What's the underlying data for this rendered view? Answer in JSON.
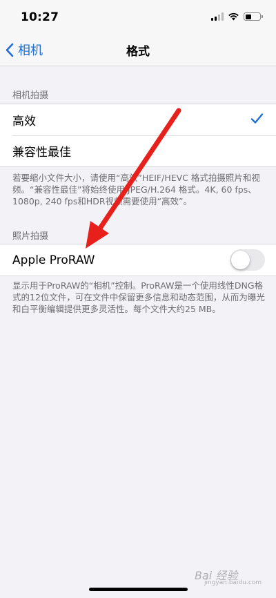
{
  "status_bar": {
    "time": "10:27"
  },
  "nav": {
    "back_label": "相机",
    "title": "格式"
  },
  "camera_capture": {
    "header": "相机拍摄",
    "options": [
      {
        "label": "高效",
        "selected": true
      },
      {
        "label": "兼容性最佳",
        "selected": false
      }
    ],
    "footer": "若要缩小文件大小，请使用“高效”HEIF/HEVC 格式拍摄照片和视频。“兼容性最佳”将始终使用 JPEG/H.264 格式。4K, 60 fps、1080p, 240 fps和HDR视频需要使用“高效”。"
  },
  "photo_capture": {
    "header": "照片拍摄",
    "proraw_label": "Apple ProRAW",
    "proraw_enabled": false,
    "footer": "显示用于ProRAW的“相机”控制。ProRAW是一个使用线性DNG格式的12位文件，可在文件中保留更多信息和动态范围，从而为曝光和白平衡编辑提供更多灵活性。每个文件大约25 MB。"
  },
  "watermark": {
    "text": "Bai 经验",
    "sub": "jingyan.baidu.com"
  },
  "colors": {
    "accent": "#1e6fd9",
    "annotation_arrow": "#e8201c"
  },
  "icons": [
    "back-chevron-icon",
    "checkmark-icon",
    "signal-icon",
    "wifi-icon",
    "battery-icon"
  ]
}
